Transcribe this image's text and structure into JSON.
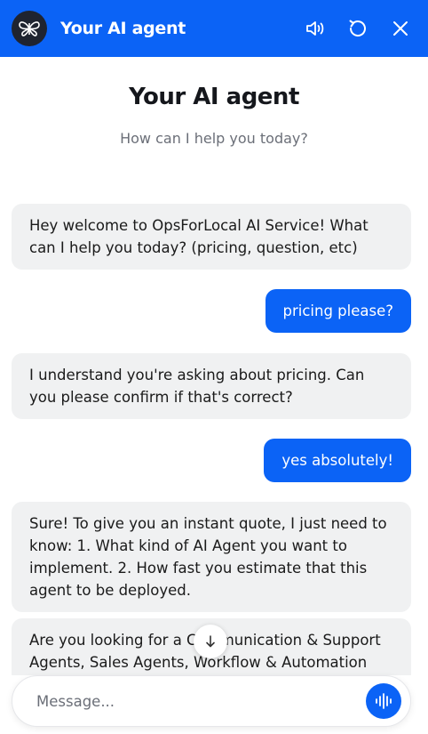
{
  "header": {
    "title": "Your AI agent",
    "logo_icon": "butterfly-logo-icon",
    "actions": [
      "speaker-icon",
      "reset-icon",
      "close-icon"
    ]
  },
  "hero": {
    "title": "Your AI agent",
    "subtitle": "How can I help you today?"
  },
  "messages": [
    {
      "role": "bot",
      "text": "Hey welcome to OpsForLocal AI Service! What can I help you today? (pricing, question, etc)"
    },
    {
      "role": "user",
      "text": "pricing please?"
    },
    {
      "role": "bot",
      "text": "I understand you're asking about pricing. Can you please confirm if that's correct?"
    },
    {
      "role": "user",
      "text": "yes absolutely!"
    },
    {
      "role": "bot",
      "text": "Sure! To give you an instant quote, I just need to know: 1. What kind of AI Agent you want to implement. 2. How fast you estimate that this agent to be deployed."
    },
    {
      "role": "bot",
      "text": "Are you looking for a Communication & Support Agents, Sales Agents, Workflow & Automation"
    }
  ],
  "composer": {
    "placeholder": "Message...",
    "value": ""
  },
  "colors": {
    "accent": "#0b63f6",
    "bot_bubble": "#f0f1f2"
  }
}
